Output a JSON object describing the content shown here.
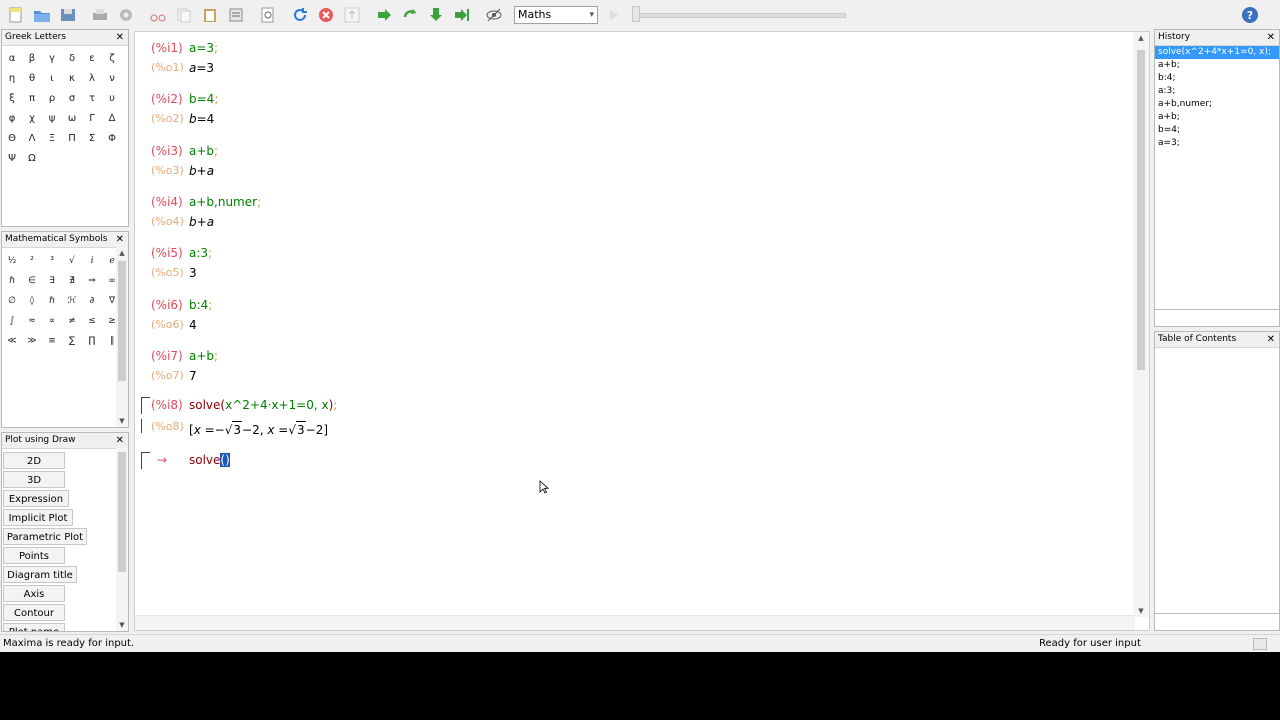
{
  "toolbar": {
    "mode_value": "Maths",
    "mode_arrow": "▾",
    "help_label": "?",
    "icons": [
      "new-file-icon",
      "open-folder-icon",
      "save-icon",
      "print-icon",
      "settings-icon",
      "cut-icon",
      "copy-icon",
      "paste-icon",
      "select-all-icon",
      "find-icon",
      "refresh-icon",
      "interrupt-icon",
      "up-icon",
      "follow-icon",
      "evaluate-icon",
      "evaluate-all-icon",
      "evaluate-to-end-icon",
      "hide-icon",
      "animation-icon",
      "help-icon"
    ]
  },
  "greek_letters": {
    "title": "Greek Letters",
    "close": "✕",
    "letters": [
      "α",
      "β",
      "γ",
      "δ",
      "ε",
      "ζ",
      "η",
      "θ",
      "ι",
      "κ",
      "λ",
      "ν",
      "ξ",
      "π",
      "ρ",
      "σ",
      "τ",
      "υ",
      "φ",
      "χ",
      "ψ",
      "ω",
      "Γ",
      "Δ",
      "Θ",
      "Λ",
      "Ξ",
      "Π",
      "Σ",
      "Φ",
      "Ψ",
      "Ω"
    ]
  },
  "math_symbols": {
    "title": "Mathematical Symbols",
    "close": "✕",
    "symbols": [
      "½",
      "²",
      "³",
      "√",
      "ⅈ",
      "ℯ",
      "ℏ",
      "∈",
      "∃",
      "∄",
      "⇒",
      "∞",
      "∅",
      "◊",
      "ℏ",
      "ℋ",
      "∂",
      "∇",
      "∫",
      "≈",
      "∝",
      "≠",
      "≤",
      "≥",
      "≪",
      "≫",
      "≡",
      "∑",
      "∏",
      "∥",
      "⇔",
      "±",
      "¬",
      "⋃",
      "⋂",
      "⊆",
      "⊂",
      "⊄",
      "⊃",
      "⇐",
      "⇛",
      "⇑"
    ]
  },
  "plot_draw": {
    "title": "Plot using Draw",
    "close": "✕",
    "buttons": [
      "2D",
      "3D",
      "Expression",
      "Implicit Plot",
      "Parametric Plot",
      "Points",
      "Diagram title",
      "Axis",
      "Contour",
      "Plot name"
    ]
  },
  "worksheet": {
    "cells": [
      {
        "in_label": "(%i1)",
        "input": "a=3",
        "semi": ";",
        "out_label": "(%o1)",
        "output": "a=3"
      },
      {
        "in_label": "(%i2)",
        "input": "b=4",
        "semi": ";",
        "out_label": "(%o2)",
        "output": "b=4"
      },
      {
        "in_label": "(%i3)",
        "input": "a+b",
        "semi": ";",
        "out_label": "(%o3)",
        "output": "b+a"
      },
      {
        "in_label": "(%i4)",
        "input": "a+b,numer",
        "semi": ";",
        "out_label": "(%o4)",
        "output": "b+a"
      },
      {
        "in_label": "(%i5)",
        "input": "a:3",
        "semi": ";",
        "out_label": "(%o5)",
        "output": "3"
      },
      {
        "in_label": "(%i6)",
        "input": "b:4",
        "semi": ";",
        "out_label": "(%o6)",
        "output": "4"
      },
      {
        "in_label": "(%i7)",
        "input": "a+b",
        "semi": ";",
        "out_label": "(%o7)",
        "output": "7"
      }
    ],
    "cell8": {
      "in_label": "(%i8)",
      "input_fn": "solve(",
      "input_expr": "x^2+4·x+1=0, x",
      "input_close": ")",
      "semi": ";",
      "out_label": "(%o8)",
      "out_open": "[",
      "out_x1": "x",
      "out_eq1": " =−",
      "out_sqrt1": "3",
      "out_rest1": "−2",
      "out_comma": ",",
      "out_x2": " x",
      "out_eq2": " =",
      "out_sqrt2": "3",
      "out_rest2": "−2",
      "out_close": "]"
    },
    "active": {
      "arrow": "→",
      "text": "solve",
      "cursor_text": "()"
    }
  },
  "history": {
    "title": "History",
    "close": "✕",
    "items": [
      "solve(x^2+4*x+1=0, x);",
      "a+b;",
      "b:4;",
      "a:3;",
      "a+b,numer;",
      "a+b;",
      "b=4;",
      "a=3;"
    ]
  },
  "toc": {
    "title": "Table of Contents",
    "close": "✕"
  },
  "status": {
    "left": "Maxima is ready for input.",
    "right": "Ready for user input"
  },
  "colors": {
    "input": "#008000",
    "in_label": "#e04a5c",
    "out_label": "#e9a878",
    "selection": "#3399ff"
  }
}
